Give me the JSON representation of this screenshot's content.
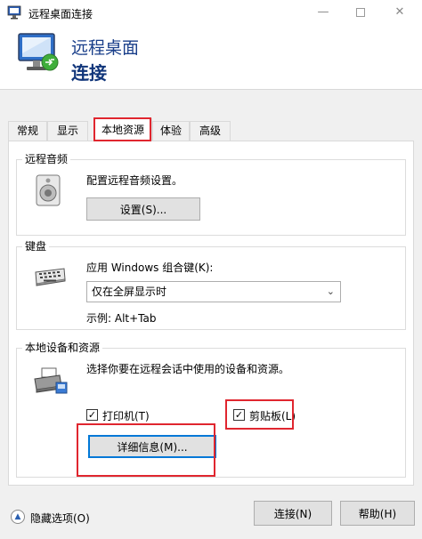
{
  "window": {
    "title": "远程桌面连接",
    "minimize": "—",
    "close": "✕"
  },
  "banner": {
    "line1": "远程桌面",
    "line2": "连接"
  },
  "tabs": [
    {
      "label": "常规"
    },
    {
      "label": "显示"
    },
    {
      "label": "本地资源"
    },
    {
      "label": "体验"
    },
    {
      "label": "高级"
    }
  ],
  "remote_audio": {
    "title": "远程音频",
    "description": "配置远程音频设置。",
    "settings_button": "设置(S)..."
  },
  "keyboard": {
    "title": "键盘",
    "label": "应用 Windows 组合键(K):",
    "selected": "仅在全屏显示时",
    "example": "示例: Alt+Tab"
  },
  "local_devices": {
    "title": "本地设备和资源",
    "description": "选择你要在远程会话中使用的设备和资源。",
    "printer_label": "打印机(T)",
    "printer_checked": true,
    "clipboard_label": "剪贴板(L)",
    "clipboard_checked": true,
    "details_button": "详细信息(M)..."
  },
  "footer": {
    "hide_options": "隐藏选项(O)",
    "connect_button": "连接(N)",
    "help_button": "帮助(H)"
  },
  "colors": {
    "highlight_frame": "#e0262f",
    "banner_text": "#1a3f8a",
    "focus_border": "#0078d7"
  }
}
